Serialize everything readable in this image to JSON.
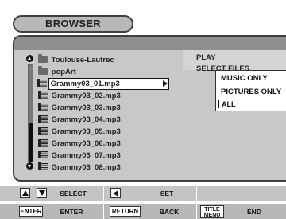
{
  "window": {
    "title": "BROWSER"
  },
  "file_list": {
    "items": [
      {
        "label": "Toulouse-Lautrec",
        "icon": "folder-icon"
      },
      {
        "label": "popArt",
        "icon": "folder-icon"
      },
      {
        "label": "Grammy03_01.mp3",
        "icon": "music-file-icon",
        "selected": true
      },
      {
        "label": "Grammy03_02.mp3",
        "icon": "music-file-icon"
      },
      {
        "label": "Grammy03_03.mp3",
        "icon": "music-file-icon"
      },
      {
        "label": "Grammy03_04.mp3",
        "icon": "music-file-icon"
      },
      {
        "label": "Grammy03_05.mp3",
        "icon": "music-file-icon"
      },
      {
        "label": "Grammy03_06.mp3",
        "icon": "music-file-icon"
      },
      {
        "label": "Grammy03_07.mp3",
        "icon": "music-file-icon"
      },
      {
        "label": "Grammy03_08.mp3",
        "icon": "music-file-icon"
      }
    ]
  },
  "submenu": {
    "play": "PLAY",
    "select_files": "SELECT FILES"
  },
  "filter_dropdown": {
    "options": [
      "MUSIC ONLY",
      "PICTURES ONLY",
      "ALL"
    ],
    "selected": "ALL"
  },
  "controls": {
    "row1": {
      "select_label": "SELECT",
      "set_label": "SET"
    },
    "row2": {
      "enter_key": "ENTER",
      "enter_label": "ENTER",
      "return_key": "RETURN",
      "back_label": "BACK",
      "title_key_line1": "TITLE",
      "title_key_line2": "MENU",
      "end_label": "END"
    }
  },
  "colors": {
    "background": "#ffffff",
    "panel": "#c8c8c8",
    "header": "#8e8e8e",
    "title_pill": "#b8b8b8",
    "text": "#222222",
    "selection": "#ffffff"
  }
}
